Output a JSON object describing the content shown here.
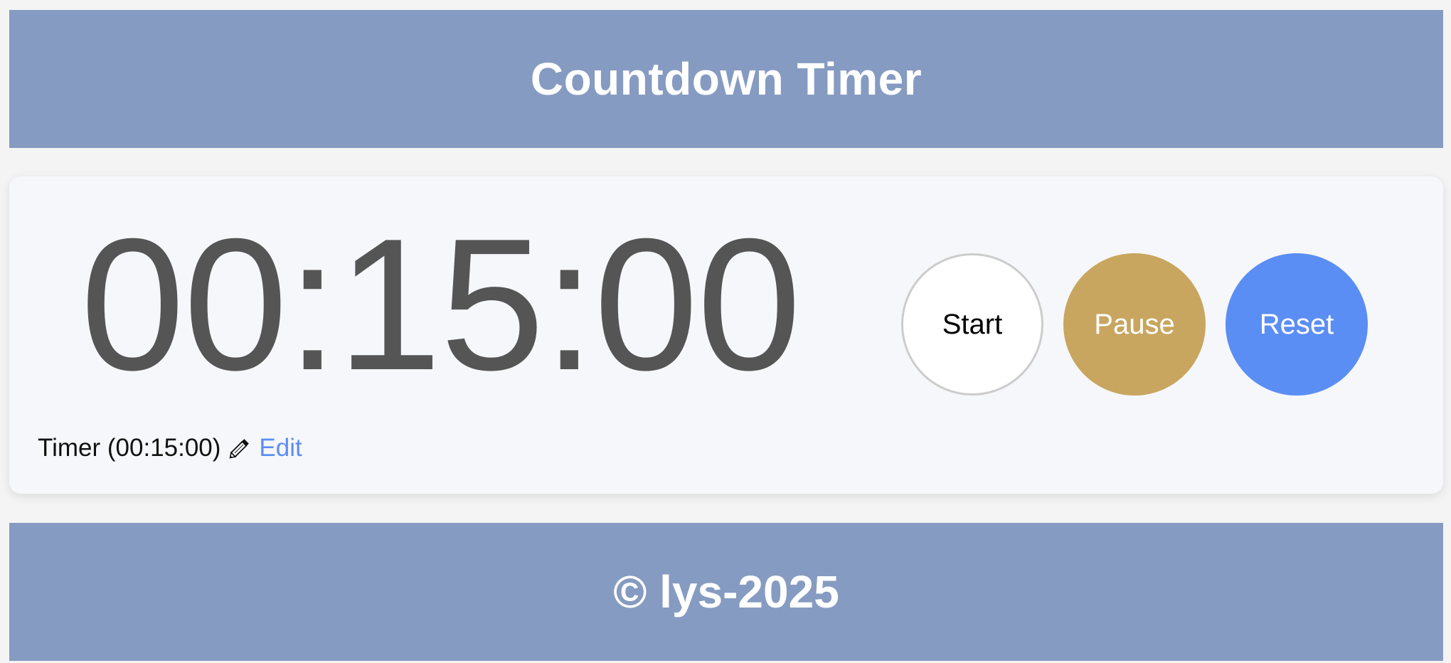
{
  "header": {
    "title": "Countdown Timer"
  },
  "timer": {
    "display": "00:15:00",
    "label": "Timer (00:15:00)",
    "edit_label": "Edit"
  },
  "controls": {
    "start_label": "Start",
    "pause_label": "Pause",
    "reset_label": "Reset"
  },
  "footer": {
    "text": "© lys-2025"
  },
  "colors": {
    "header_bg": "#869bc1",
    "footer_bg": "#869bc1",
    "card_bg": "#f6f7fa",
    "pause_button": "#c8a65f",
    "reset_button": "#5b8ef4",
    "edit_link": "#5b8ef4",
    "time_text": "#555555"
  },
  "icons": {
    "edit": "pencil-icon"
  }
}
